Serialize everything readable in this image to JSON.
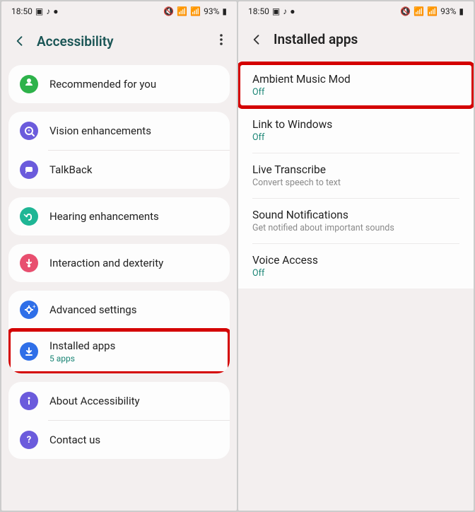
{
  "status": {
    "time": "18:50",
    "battery": "93%"
  },
  "screen1": {
    "title": "Accessibility",
    "groups": [
      {
        "rows": [
          {
            "icon": "person-green",
            "label": "Recommended for you"
          }
        ]
      },
      {
        "rows": [
          {
            "icon": "eye-purple",
            "label": "Vision enhancements"
          },
          {
            "icon": "talkback-purple",
            "label": "TalkBack"
          }
        ]
      },
      {
        "rows": [
          {
            "icon": "ear-teal",
            "label": "Hearing enhancements"
          }
        ]
      },
      {
        "rows": [
          {
            "icon": "touch-pink",
            "label": "Interaction and dexterity"
          }
        ]
      },
      {
        "rows": [
          {
            "icon": "gear-blue",
            "label": "Advanced settings"
          },
          {
            "icon": "download-blue",
            "label": "Installed apps",
            "sub": "5 apps",
            "highlight": true
          }
        ]
      },
      {
        "rows": [
          {
            "icon": "info-purple",
            "label": "About Accessibility"
          },
          {
            "icon": "help-purple",
            "label": "Contact us"
          }
        ]
      }
    ]
  },
  "screen2": {
    "title": "Installed apps",
    "items": [
      {
        "label": "Ambient Music Mod",
        "sub": "Off",
        "subcolor": "teal",
        "highlight": true
      },
      {
        "label": "Link to Windows",
        "sub": "Off",
        "subcolor": "teal"
      },
      {
        "label": "Live Transcribe",
        "sub": "Convert speech to text",
        "subcolor": "grey"
      },
      {
        "label": "Sound Notifications",
        "sub": "Get notified about important sounds",
        "subcolor": "grey"
      },
      {
        "label": "Voice Access",
        "sub": "Off",
        "subcolor": "teal"
      }
    ]
  }
}
